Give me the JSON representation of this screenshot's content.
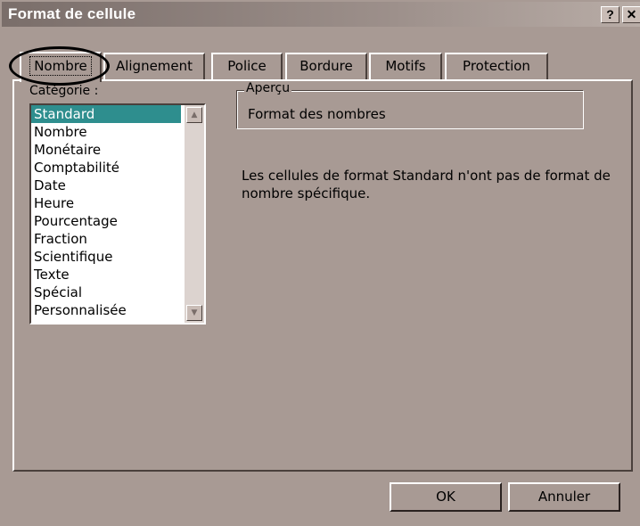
{
  "window": {
    "title": "Format de cellule",
    "help_label": "?",
    "close_label": "✕"
  },
  "tabs": [
    {
      "label": "Nombre",
      "selected": true
    },
    {
      "label": "Alignement"
    },
    {
      "label": "Police"
    },
    {
      "label": "Bordure"
    },
    {
      "label": "Motifs"
    },
    {
      "label": "Protection"
    }
  ],
  "category": {
    "label": "Catégorie :",
    "items": [
      "Standard",
      "Nombre",
      "Monétaire",
      "Comptabilité",
      "Date",
      "Heure",
      "Pourcentage",
      "Fraction",
      "Scientifique",
      "Texte",
      "Spécial",
      "Personnalisée"
    ],
    "selected": "Standard"
  },
  "preview": {
    "legend": "Aperçu",
    "value": "Format des nombres"
  },
  "description": "Les cellules de format Standard n'ont pas de format de nombre spécifique.",
  "buttons": {
    "ok": "OK",
    "cancel": "Annuler"
  },
  "colors": {
    "dialog_bg": "#a89a94",
    "selection": "#2e8e8e"
  }
}
